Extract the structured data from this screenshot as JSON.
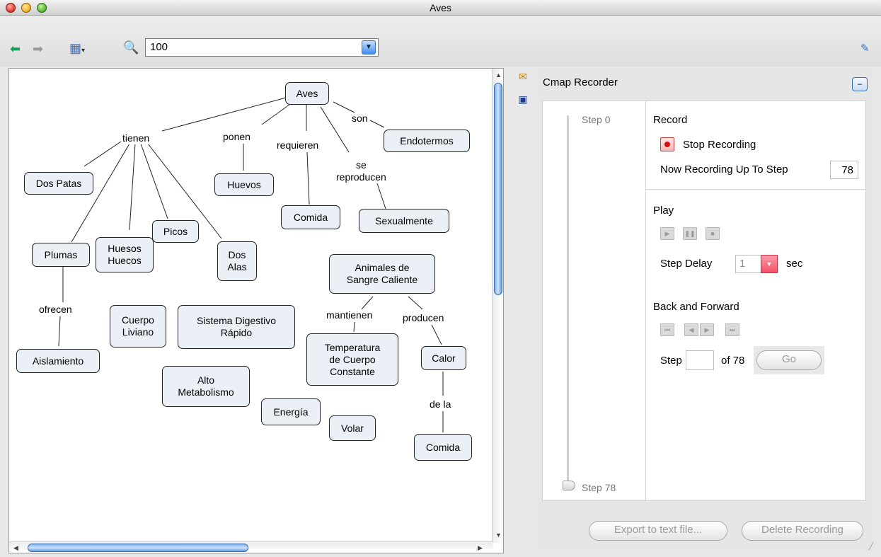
{
  "window": {
    "title": "Aves"
  },
  "toolbar": {
    "zoom_value": "100",
    "icons": [
      "back-arrow-icon",
      "forward-arrow-icon",
      "view-menu-icon",
      "zoom-icon",
      "dropdown-arrow-icon",
      "tools-icon"
    ]
  },
  "cmap": {
    "nodes": {
      "aves": "Aves",
      "endotermos": "Endotermos",
      "dos_patas": "Dos Patas",
      "huevos": "Huevos",
      "comida1": "Comida",
      "sexualmente": "Sexualmente",
      "picos": "Picos",
      "plumas": "Plumas",
      "huesos_huecos": "Huesos\nHuecos",
      "dos_alas": "Dos\nAlas",
      "animales": "Animales de\nSangre Caliente",
      "cuerpo_liviano": "Cuerpo\nLiviano",
      "sistema": "Sistema Digestivo\nRápido",
      "temperatura": "Temperatura\nde Cuerpo\nConstante",
      "calor": "Calor",
      "aislamiento": "Aislamiento",
      "alto_metab": "Alto\nMetabolismo",
      "energia": "Energía",
      "volar": "Volar",
      "comida2": "Comida"
    },
    "links": {
      "son": "son",
      "tienen": "tienen",
      "ponen": "ponen",
      "requieren": "requieren",
      "se_reproducen": "se\nreproducen",
      "ofrecen": "ofrecen",
      "mantienen": "mantienen",
      "producen": "producen",
      "de_la": "de la"
    }
  },
  "recorder": {
    "title": "Cmap Recorder",
    "step_start": "Step 0",
    "step_end": "Step 78",
    "record_title": "Record",
    "stop_label": "Stop Recording",
    "now_recording_label": "Now Recording Up To Step",
    "now_recording_value": "78",
    "play_title": "Play",
    "step_delay_label": "Step Delay",
    "step_delay_value": "1",
    "sec_label": "sec",
    "back_forward_title": "Back and Forward",
    "step_label": "Step",
    "of_label": "of 78",
    "go_label": "Go",
    "export_label": "Export to text file...",
    "delete_label": "Delete Recording"
  }
}
